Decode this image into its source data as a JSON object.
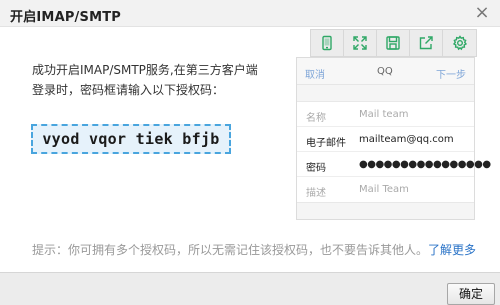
{
  "dialog": {
    "title": "开启IMAP/SMTP",
    "close_icon": "×"
  },
  "message": {
    "line1": "成功开启IMAP/SMTP服务,在第三方客户端",
    "line2": "登录时，密码框请输入以下授权码："
  },
  "auth_code": "vyod vqor tiek bfjb",
  "tip": {
    "text": "提示：你可拥有多个授权码，所以无需记住该授权码，也不要告诉其他人。",
    "link": "了解更多"
  },
  "toolbar": {
    "icons": [
      "phone-icon",
      "expand-icon",
      "save-icon",
      "export-icon",
      "settings-icon"
    ],
    "accent_color": "#2fa866"
  },
  "phone_preview": {
    "nav": {
      "cancel": "取消",
      "title": "QQ",
      "next": "下一步"
    },
    "rows": [
      {
        "label": "名称",
        "value": "Mail team"
      },
      {
        "label": "电子邮件",
        "value": "mailteam@qq.com"
      },
      {
        "label": "密码",
        "value": "●●●●●●●●●●●●●●●●"
      },
      {
        "label": "描述",
        "value": "Mail Team"
      }
    ]
  },
  "footer": {
    "ok_label": "确定"
  }
}
